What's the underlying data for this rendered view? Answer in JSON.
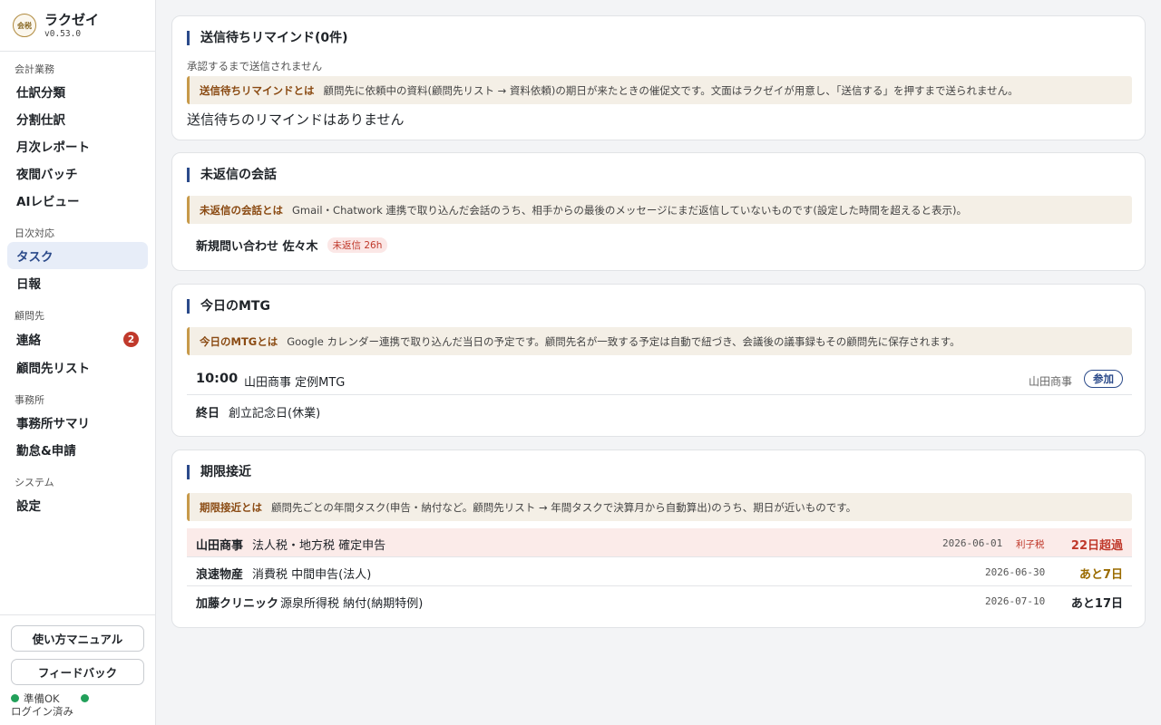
{
  "app": {
    "name": "ラクゼイ",
    "version": "v0.53.0",
    "logo_text": "会税"
  },
  "sidebar": {
    "sections": [
      {
        "label": "会計業務",
        "items": [
          {
            "label": "仕訳分類"
          },
          {
            "label": "分割仕訳"
          },
          {
            "label": "月次レポート"
          },
          {
            "label": "夜間バッチ"
          },
          {
            "label": "AIレビュー"
          }
        ]
      },
      {
        "label": "日次対応",
        "items": [
          {
            "label": "タスク",
            "active": true
          },
          {
            "label": "日報"
          }
        ]
      },
      {
        "label": "顧問先",
        "items": [
          {
            "label": "連絡",
            "badge": "2"
          },
          {
            "label": "顧問先リスト"
          }
        ]
      },
      {
        "label": "事務所",
        "items": [
          {
            "label": "事務所サマリ"
          },
          {
            "label": "勤怠&申請"
          }
        ]
      },
      {
        "label": "システム",
        "items": [
          {
            "label": "設定"
          }
        ]
      }
    ],
    "footer": {
      "manual_label": "使い方マニュアル",
      "feedback_label": "フィードバック",
      "status_ready": "準備OK",
      "status_login": "ログイン済み"
    }
  },
  "reminders": {
    "title": "送信待ちリマインド(0件)",
    "subtitle": "承認するまで送信されません",
    "note_label": "送信待ちリマインドとは",
    "note_text": "顧問先に依頼中の資料(顧問先リスト → 資料依頼)の期日が来たときの催促文です。文面はラクゼイが用意し、「送信する」を押すまで送られません。",
    "empty": "送信待ちのリマインドはありません"
  },
  "unreplied": {
    "title": "未返信の会話",
    "note_label": "未返信の会話とは",
    "note_text": "Gmail・Chatwork 連携で取り込んだ会話のうち、相手からの最後のメッセージにまだ返信していないものです(設定した時間を超えると表示)。",
    "items": [
      {
        "name": "新規問い合わせ 佐々木",
        "badge": "未返信 26h"
      }
    ]
  },
  "meetings": {
    "title": "今日のMTG",
    "note_label": "今日のMTGとは",
    "note_text": "Google カレンダー連携で取り込んだ当日の予定です。顧問先名が一致する予定は自動で紐づき、会議後の議事録もその顧問先に保存されます。",
    "items": [
      {
        "time": "10:00",
        "title": "山田商事 定例MTG",
        "client": "山田商事",
        "action": "参加"
      },
      {
        "time": "終日",
        "title": "創立記念日(休業)"
      }
    ]
  },
  "deadlines": {
    "title": "期限接近",
    "note_label": "期限接近とは",
    "note_text": "顧問先ごとの年間タスク(申告・納付など。顧問先リスト → 年間タスクで決算月から自動算出)のうち、期日が近いものです。",
    "items": [
      {
        "client": "山田商事",
        "task": "法人税・地方税 確定申告",
        "date": "2026-06-01",
        "tag": "利子税",
        "remaining": "22日超過",
        "status": "overdue",
        "color": "#c0392b"
      },
      {
        "client": "浪速物産",
        "task": "消費税 中間申告(法人)",
        "date": "2026-06-30",
        "remaining": "あと7日",
        "status": "soon",
        "color": "#9a6b00"
      },
      {
        "client": "加藤クリニック",
        "task": "源泉所得税 納付(納期特例)",
        "date": "2026-07-10",
        "remaining": "あと17日",
        "status": "normal",
        "color": "#1f2328"
      }
    ]
  }
}
